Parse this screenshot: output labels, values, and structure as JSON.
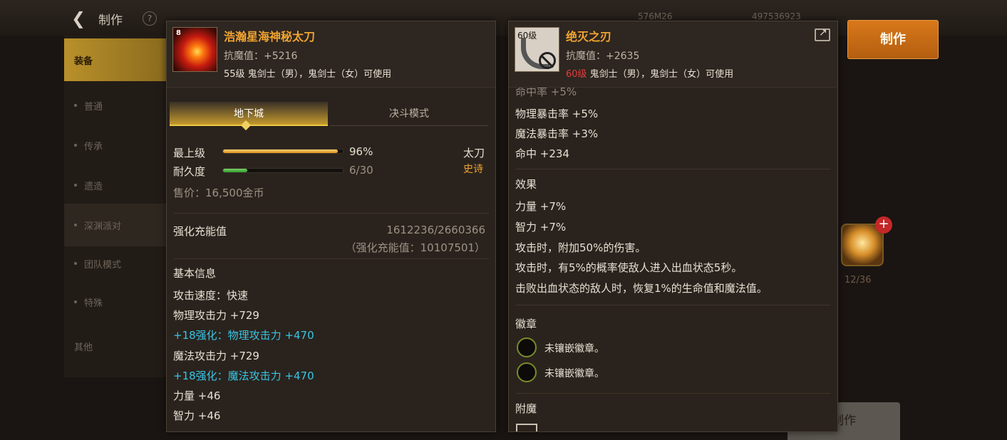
{
  "topbar": {
    "title": "制作",
    "help": "?",
    "stat1": "576M26",
    "stat2": "497536923"
  },
  "sidebar": {
    "items": [
      {
        "label": "装备"
      },
      {
        "label": "普通"
      },
      {
        "label": "传承"
      },
      {
        "label": "遗造"
      },
      {
        "label": "深渊派对"
      },
      {
        "label": "团队模式"
      },
      {
        "label": "特殊"
      },
      {
        "label": "其他"
      }
    ]
  },
  "craft_button": "制作",
  "material": {
    "count": "12/36",
    "plus": "+"
  },
  "ghost_button": "制作",
  "left_panel": {
    "name": "浩瀚星海神秘太刀",
    "icon_tag": "8",
    "resist": "抗魔值：+5216",
    "requirement": "55级 鬼剑士（男），鬼剑士（女）可使用",
    "tabs": [
      "地下城",
      "决斗模式"
    ],
    "max_level_label": "最上级",
    "max_level_value": "96%",
    "max_level_fraction": 0.96,
    "durability_label": "耐久度",
    "durability_value": "6/30",
    "durability_fraction": 0.2,
    "weapon_type": "太刀",
    "rarity": "史诗",
    "price": "售价：16,500金币",
    "charge_label": "强化充能值",
    "charge_value": "1612236/2660366",
    "charge_total": "（强化充能值：10107501）",
    "basic_info_title": "基本信息",
    "stats": [
      {
        "text": "攻击速度：快速",
        "style": "normal"
      },
      {
        "text": "物理攻击力 +729",
        "style": "normal"
      },
      {
        "text": "+18强化：物理攻击力 +470",
        "style": "cyan"
      },
      {
        "text": "魔法攻击力 +729",
        "style": "normal"
      },
      {
        "text": "+18强化：魔法攻击力 +470",
        "style": "cyan"
      },
      {
        "text": "力量 +46",
        "style": "normal"
      },
      {
        "text": "智力 +46",
        "style": "normal"
      }
    ]
  },
  "right_panel": {
    "name": "绝灭之刃",
    "icon_level": "60级",
    "resist": "抗魔值：+2635",
    "req_level": "60级",
    "requirement": " 鬼剑士（男），鬼剑士（女）可使用",
    "partial_line": "命中率 +5%",
    "stats": [
      "物理暴击率 +5%",
      "魔法暴击率 +3%",
      "命中 +234"
    ],
    "effect_title": "效果",
    "effects": [
      "力量 +7%",
      "智力 +7%",
      "攻击时，附加50%的伤害。",
      "攻击时，有5%的概率使敌人进入出血状态5秒。",
      "击败出血状态的敌人时，恢复1%的生命值和魔法值。"
    ],
    "emblem_title": "徽章",
    "emblems": [
      "未镶嵌徽章。",
      "未镶嵌徽章。"
    ],
    "enchant_title": "附魔"
  }
}
